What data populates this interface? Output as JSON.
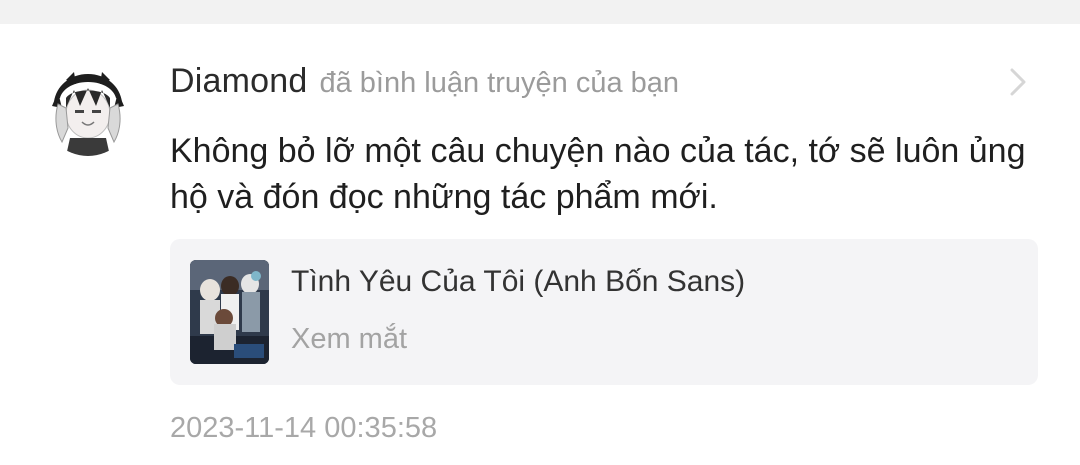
{
  "notification": {
    "username": "Diamond",
    "action_text": "đã bình luận truyện của bạn",
    "comment_text": "Không bỏ lỡ một câu chuyện nào của tác, tớ sẽ luôn ủng hộ và đón đọc những tác phẩm mới.",
    "timestamp": "2023-11-14 00:35:58",
    "avatar_icon": "anime-avatar",
    "chevron_icon": "chevron-right-icon"
  },
  "story": {
    "title": "Tình Yêu Của Tôi (Anh Bốn Sans)",
    "subtitle": "Xem mắt",
    "cover_icon": "story-cover-image"
  },
  "colors": {
    "page_background": "#f2f2f2",
    "card_background": "#ffffff",
    "story_card_background": "#f4f4f6",
    "username": "#2b2b2b",
    "muted_text": "#9b9b9b",
    "timestamp": "#a8a8a8"
  }
}
